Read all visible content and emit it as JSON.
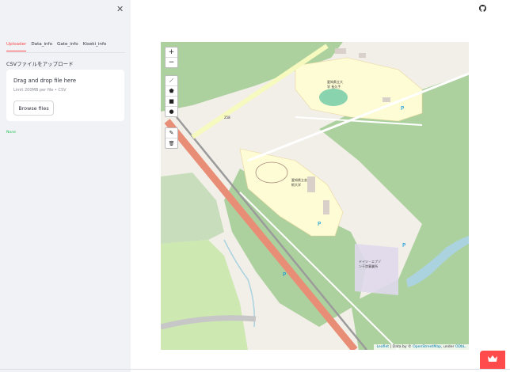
{
  "sidebar": {
    "tabs": [
      {
        "label": "Uploader"
      },
      {
        "label": "Data_info"
      },
      {
        "label": "Gate_info"
      },
      {
        "label": "Kiseki_info"
      }
    ],
    "csv_label": "CSVファイルをアップロード",
    "uploader": {
      "title": "Drag and drop file here",
      "limit": "Limit 200MB per file • CSV",
      "browse_label": "Browse files"
    },
    "result_text": "None"
  },
  "map": {
    "controls": {
      "zoom_in": "+",
      "zoom_out": "−",
      "draw_line": "⟋",
      "draw_polygon": "⬟",
      "draw_rect": "■",
      "draw_marker": "●",
      "edit": "✎",
      "delete": "🗑"
    },
    "attribution": {
      "leaflet": "Leaflet",
      "data_by": " | Data by © ",
      "osm": "OpenStreetMap",
      "under": ", under ",
      "odbl": "ODbL."
    },
    "labels": {
      "road_258": "258",
      "univ1": "愛知県立大学 長久手",
      "univ2": "愛知県立芸術大学",
      "facility": "ドイツ・エブゾン干渉事業所",
      "parking": "P"
    }
  },
  "colors": {
    "accent": "#ff4b4b",
    "sidebar_bg": "#f0f2f6",
    "park": "#a7d49f",
    "forest": "#add19e",
    "campus": "#fefcd5",
    "road_main": "#e88e76",
    "water": "#aad3df"
  }
}
